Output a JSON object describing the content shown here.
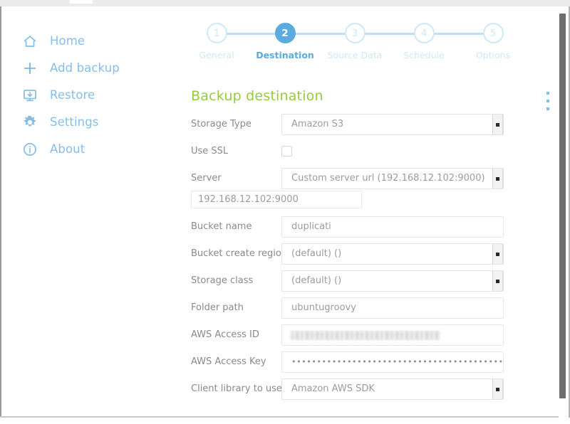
{
  "sidebar": {
    "items": [
      {
        "label": "Home",
        "icon": "home-icon"
      },
      {
        "label": "Add backup",
        "icon": "plus-icon"
      },
      {
        "label": "Restore",
        "icon": "restore-monitor-icon"
      },
      {
        "label": "Settings",
        "icon": "gear-icon"
      },
      {
        "label": "About",
        "icon": "info-circle-icon"
      }
    ]
  },
  "stepper": {
    "steps": [
      {
        "number": "1",
        "label": "General",
        "active": false
      },
      {
        "number": "2",
        "label": "Destination",
        "active": true
      },
      {
        "number": "3",
        "label": "Source Data",
        "active": false
      },
      {
        "number": "4",
        "label": "Schedule",
        "active": false
      },
      {
        "number": "5",
        "label": "Options",
        "active": false
      }
    ]
  },
  "main": {
    "section_title": "Backup destination",
    "kebab_menu": "more-options",
    "fields": {
      "storage_type": {
        "label": "Storage Type",
        "value": "Amazon S3"
      },
      "use_ssl": {
        "label": "Use SSL",
        "checked": false
      },
      "server": {
        "label": "Server",
        "value": "Custom server url (192.168.12.102:9000)"
      },
      "server_url": {
        "value": "192.168.12.102:9000"
      },
      "bucket_name": {
        "label": "Bucket name",
        "value": "duplicati"
      },
      "bucket_region": {
        "label": "Bucket create region",
        "value": "(default) ()"
      },
      "storage_class": {
        "label": "Storage class",
        "value": "(default) ()"
      },
      "folder_path": {
        "label": "Folder path",
        "value": "ubuntugroovy"
      },
      "aws_access_id": {
        "label": "AWS Access ID",
        "value": ""
      },
      "aws_access_key": {
        "label": "AWS Access Key",
        "value": "••••••••••••••••••••••••••••••••••••••••••••••••••••••••••••••••••"
      },
      "client_library": {
        "label": "Client library to use",
        "value": "Amazon AWS SDK"
      }
    }
  },
  "colors": {
    "accent_blue": "#5babdf",
    "muted_blue": "#cfe8f7",
    "sidebar_blue": "#86bee8",
    "heading_green": "#94cc3e",
    "label_gray": "#8a8a8a"
  }
}
